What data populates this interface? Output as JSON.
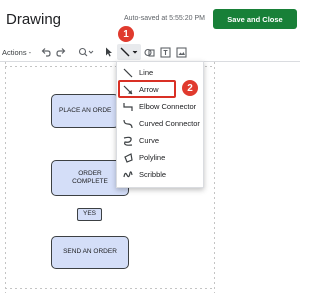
{
  "app": {
    "title": "Drawing",
    "autosave": "Auto-saved at 5:55:20 PM",
    "save_close_label": "Save and Close"
  },
  "toolbar": {
    "actions_label": "Actions -",
    "icons": [
      "undo-icon",
      "redo-icon",
      "zoom-icon",
      "select-icon",
      "line-icon",
      "shape-icon",
      "text-box-icon",
      "image-icon"
    ]
  },
  "line_menu": {
    "items": [
      {
        "label": "Line",
        "icon": "line-icon"
      },
      {
        "label": "Arrow",
        "icon": "arrow-icon"
      },
      {
        "label": "Elbow Connector",
        "icon": "elbow-connector-icon"
      },
      {
        "label": "Curved Connector",
        "icon": "curved-connector-icon"
      },
      {
        "label": "Curve",
        "icon": "curve-icon"
      },
      {
        "label": "Polyline",
        "icon": "polyline-icon"
      },
      {
        "label": "Scribble",
        "icon": "scribble-icon"
      }
    ],
    "highlighted": "Arrow"
  },
  "canvas": {
    "shapes": [
      {
        "text": "PLACE AN ORDE"
      },
      {
        "text": "ORDER\nCOMPLETE"
      },
      {
        "text": "YES"
      },
      {
        "text": "SEND AN ORDER"
      }
    ]
  },
  "annotations": [
    {
      "number": "1"
    },
    {
      "number": "2"
    }
  ],
  "colors": {
    "save_button": "#188038",
    "shape_fill": "#d4def8",
    "annotation_red": "#e03a2e"
  }
}
